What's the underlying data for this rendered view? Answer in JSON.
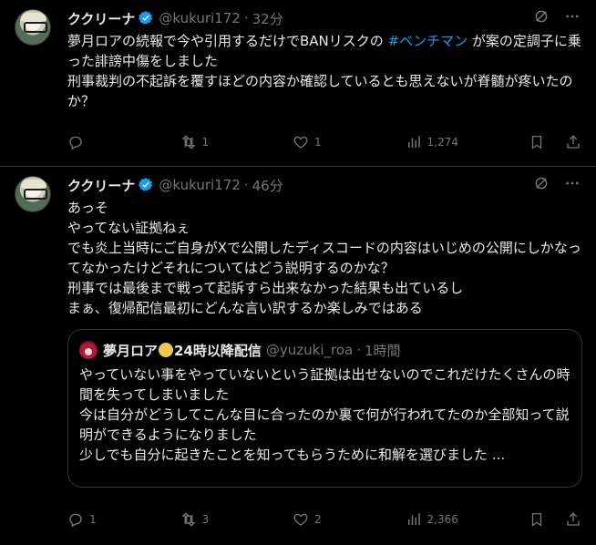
{
  "tweets": [
    {
      "name": "ククリーナ",
      "handle": "@kukuri172",
      "dot": "·",
      "time": "32分",
      "text_before_tag": "夢月ロアの続報で今や引用するだけでBANリスクの ",
      "hashtag": "#ベンチマン",
      "text_after_tag": " が案の定調子に乗った誹謗中傷をしました\n刑事裁判の不起訴を覆すほどの内容か確認しているとも思えないが脊髄が疼いたのか？",
      "replies": "",
      "retweets": "1",
      "likes": "1",
      "views": "1,274"
    },
    {
      "name": "ククリーナ",
      "handle": "@kukuri172",
      "dot": "·",
      "time": "46分",
      "text": "あっそ\nやってない証拠ねぇ\nでも炎上当時にご自身がXで公開したディスコードの内容はいじめの公開にしかなってなかったけどそれについてはどう説明するのかな？\n刑事では最後まで戦って起訴すら出来なかった結果も出ているし\nまぁ、復帰配信最初にどんな言い訳するか楽しみではある",
      "quote": {
        "name_part1": "夢月ロア",
        "name_part2": "24時以降配信",
        "handle": "@yuzuki_roa",
        "dot": "·",
        "time": "1時間",
        "text": "やっていない事をやっていないという証拠は出せないのでこれだけたくさんの時間を失ってしまいました\n今は自分がどうしてこんな目に合ったのか裏で何が行われてたのか全部知って説明ができるようになりました\n少しでも自分に起きたことを知ってもらうために和解を選びました ..."
      },
      "replies": "1",
      "retweets": "3",
      "likes": "2",
      "views": "2,366"
    }
  ],
  "colors": {
    "background": "#000000",
    "text": "#e7e9ea",
    "muted": "#71767b",
    "link": "#1d9bf0",
    "verified": "#1d9bf0",
    "border": "#2f3336"
  },
  "icons": [
    "grok-icon",
    "more-icon",
    "reply-icon",
    "retweet-icon",
    "like-icon",
    "views-icon",
    "bookmark-icon",
    "share-icon",
    "verified-badge-icon"
  ]
}
